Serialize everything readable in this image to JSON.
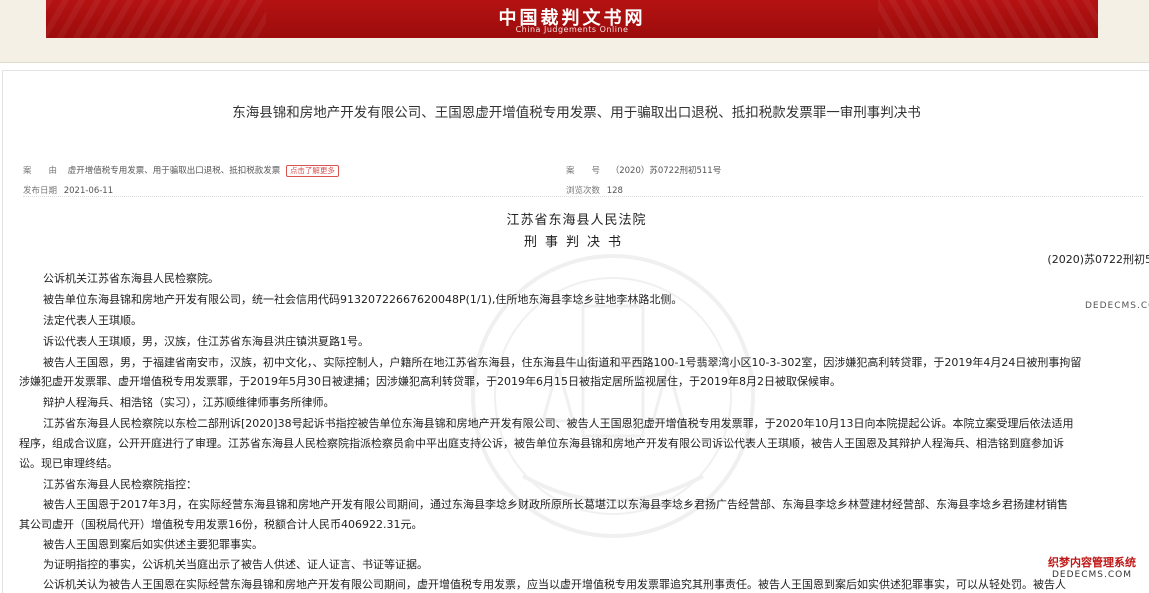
{
  "header": {
    "logo_cn": "中国裁判文书网",
    "logo_en": "China Judgements Online"
  },
  "document": {
    "title": "东海县锦和房地产开发有限公司、王国恩虚开增值税专用发票、用于骗取出口退税、抵扣税款发票罪一审刑事判决书",
    "meta": {
      "cause_label": "案　　由",
      "cause_value": "虚开增值税专用发票、用于骗取出口退税、抵扣税款发票",
      "more_label": "点击了解更多",
      "case_no_label": "案　　号",
      "case_no_value": "（2020）苏0722刑初511号",
      "publish_label": "发布日期",
      "publish_value": "2021-06-11",
      "views_label": "浏览次数",
      "views_value": "128"
    },
    "court": "江苏省东海县人民法院",
    "doc_type": "刑事判决书",
    "case_number": "(2020)苏0722刑初5",
    "paragraphs": [
      "公诉机关江苏省东海县人民检察院。",
      "被告单位东海县锦和房地产开发有限公司，统一社会信用代码91320722667620048P(1/1),住所地东海县李埝乡驻地李林路北侧。",
      "法定代表人王琪顺。",
      "诉讼代表人王琪顺，男，汉族，住江苏省东海县洪庄镇洪夏路1号。",
      "被告人王国恩，男，于福建省南安市，汉族，初中文化，、实际控制人，户籍所在地江苏省东海县，住东海县牛山街道和平西路100-1号翡翠湾小区10-3-302室，因涉嫌犯高利转贷罪，于2019年4月24日被刑事拘留",
      "涉嫌犯虚开发票罪、虚开增值税专用发票罪，于2019年5月30日被逮捕；因涉嫌犯高利转贷罪，于2019年6月15日被指定居所监视居住，于2019年8月2日被取保候审。",
      "辩护人程海兵、相浩铭（实习），江苏顺维律师事务所律师。",
      "江苏省东海县人民检察院以东检二部刑诉[2020]38号起诉书指控被告单位东海县锦和房地产开发有限公司、被告人王国恩犯虚开增值税专用发票罪，于2020年10月13日向本院提起公诉。本院立案受理后依法适用",
      "程序，组成合议庭，公开开庭进行了审理。江苏省东海县人民检察院指派检察员俞中平出庭支持公诉，被告单位东海县锦和房地产开发有限公司诉讼代表人王琪顺，被告人王国恩及其辩护人程海兵、相浩铭到庭参加诉",
      "讼。现已审理终结。",
      "江苏省东海县人民检察院指控：",
      "被告人王国恩于2017年3月，在实际经营东海县锦和房地产开发有限公司期间，通过东海县李埝乡财政所原所长葛堪江以东海县李埝乡君扬广告经营部、东海县李埝乡林萱建材经营部、东海县李埝乡君扬建材销售",
      "其公司虚开（国税局代开）增值税专用发票16份，税额合计人民币406922.31元。",
      "被告人王国恩到案后如实供述主要犯罪事实。",
      "为证明指控的事实，公诉机关当庭出示了被告人供述、证人证言、书证等证据。",
      "公诉机关认为被告人王国恩在实际经营东海县锦和房地产开发有限公司期间，虚开增值税专用发票，应当以虚开增值税专用发票罪追究其刑事责任。被告人王国恩到案后如实供述犯罪事实，可以从轻处罚。被告人"
    ]
  },
  "overlays": {
    "side_url": "DEDECMS.COM",
    "corner_cn": "织梦内容管理系统",
    "corner_url": "DEDECMS.COM"
  }
}
